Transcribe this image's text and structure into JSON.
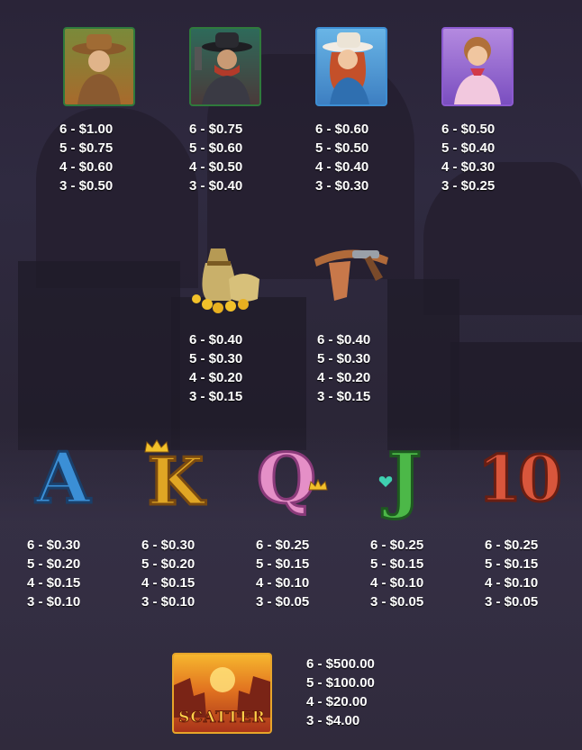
{
  "premium": [
    {
      "id": "cowboy",
      "icon": "cowboy-icon",
      "pays": [
        "6 - $1.00",
        "5 - $0.75",
        "4 - $0.60",
        "3 - $0.50"
      ]
    },
    {
      "id": "bandit",
      "icon": "bandit-icon",
      "pays": [
        "6 - $0.75",
        "5 - $0.60",
        "4 - $0.50",
        "3 - $0.40"
      ]
    },
    {
      "id": "cowgirl",
      "icon": "cowgirl-icon",
      "pays": [
        "6 - $0.60",
        "5 - $0.50",
        "4 - $0.40",
        "3 - $0.30"
      ]
    },
    {
      "id": "saloon-girl",
      "icon": "saloon-girl-icon",
      "pays": [
        "6 - $0.50",
        "5 - $0.40",
        "4 - $0.30",
        "3 - $0.25"
      ]
    }
  ],
  "mid": [
    {
      "id": "gold-bag",
      "icon": "gold-bag-icon",
      "pays": [
        "6 - $0.40",
        "5 - $0.30",
        "4 - $0.20",
        "3 - $0.15"
      ]
    },
    {
      "id": "holster",
      "icon": "gun-holster-icon",
      "pays": [
        "6 - $0.40",
        "5 - $0.30",
        "4 - $0.20",
        "3 - $0.15"
      ]
    }
  ],
  "low": [
    {
      "id": "ace",
      "glyph": "A",
      "color": "#3b8fd6",
      "pays": [
        "6 - $0.30",
        "5 - $0.20",
        "4 - $0.15",
        "3 - $0.10"
      ]
    },
    {
      "id": "king",
      "glyph": "K",
      "color": "#e0a624",
      "pays": [
        "6 - $0.30",
        "5 - $0.20",
        "4 - $0.15",
        "3 - $0.10"
      ]
    },
    {
      "id": "queen",
      "glyph": "Q",
      "color": "#e58fc7",
      "pays": [
        "6 - $0.25",
        "5 - $0.15",
        "4 - $0.10",
        "3 - $0.05"
      ]
    },
    {
      "id": "jack",
      "glyph": "J",
      "color": "#4cb848",
      "pays": [
        "6 - $0.25",
        "5 - $0.15",
        "4 - $0.10",
        "3 - $0.05"
      ]
    },
    {
      "id": "ten",
      "glyph": "10",
      "color": "#d9563c",
      "pays": [
        "6 - $0.25",
        "5 - $0.15",
        "4 - $0.10",
        "3 - $0.05"
      ]
    }
  ],
  "scatter": {
    "label": "SCATTER",
    "icon": "scatter-icon",
    "pays": [
      "6 - $500.00",
      "5 - $100.00",
      "4 - $20.00",
      "3 - $4.00"
    ]
  }
}
